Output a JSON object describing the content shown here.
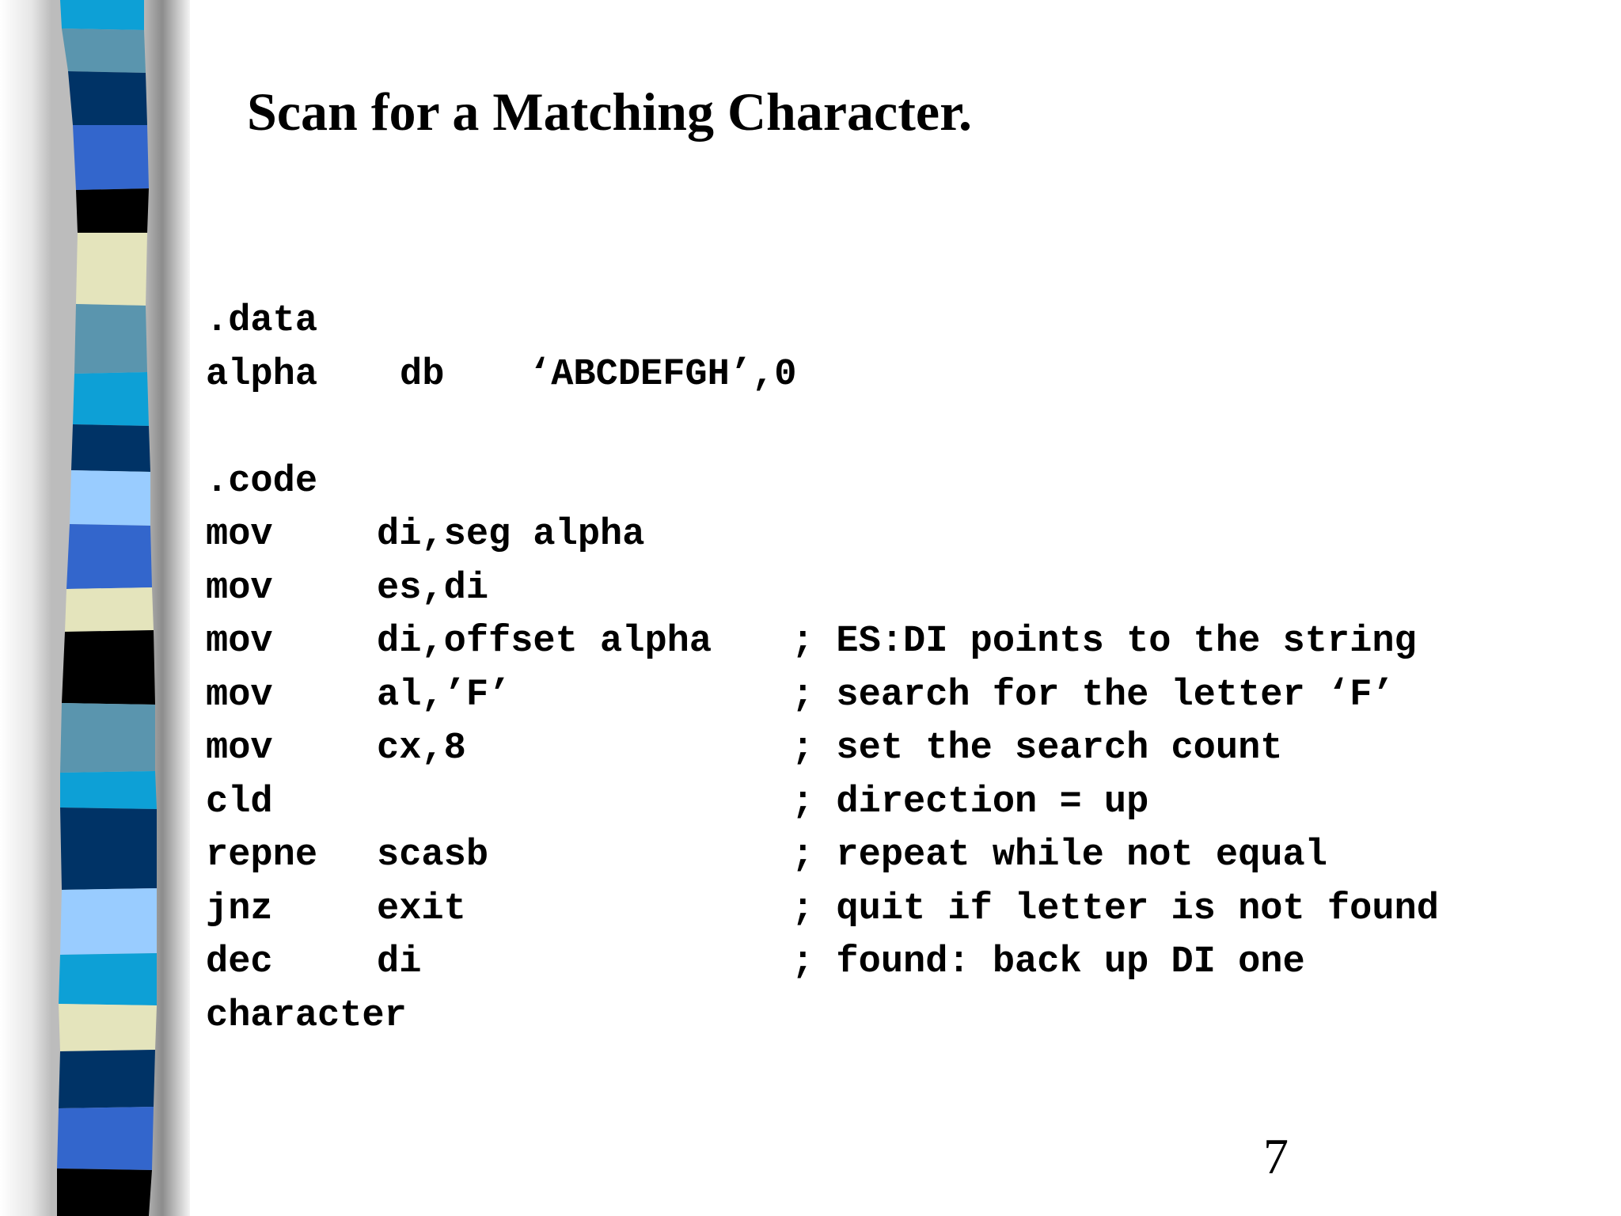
{
  "slide": {
    "title": "Scan for a Matching Character.",
    "page_number": "7"
  },
  "code": {
    "data_section": ".data",
    "data_line": {
      "label": "alpha",
      "directive": "db",
      "value": "‘ABCDEFGH’,0"
    },
    "code_section": ".code",
    "lines": [
      {
        "op": "mov",
        "arg": "di,seg alpha",
        "comment": ""
      },
      {
        "op": "mov",
        "arg": "es,di",
        "comment": ""
      },
      {
        "op": "mov",
        "arg": "di,offset alpha",
        "comment": "; ES:DI points to the string"
      },
      {
        "op": "mov",
        "arg": "al,’F’",
        "comment": "; search for the letter ‘F’"
      },
      {
        "op": "mov",
        "arg": "cx,8",
        "comment": "; set the search count"
      },
      {
        "op": "cld",
        "arg": "",
        "comment": "; direction = up"
      },
      {
        "op": "repne",
        "arg": "scasb",
        "comment": "; repeat while not equal"
      },
      {
        "op": "jnz",
        "arg": "exit",
        "comment": "; quit if letter is not found"
      },
      {
        "op": "dec",
        "arg": "di",
        "comment": "; found: back up DI one"
      }
    ],
    "wrap_line": "character"
  },
  "decoration": {
    "stripe_colors": [
      "#0da0d6",
      "#5a95ae",
      "#003366",
      "#3366cc",
      "#000000",
      "#e4e4bc",
      "#99ccff"
    ]
  }
}
